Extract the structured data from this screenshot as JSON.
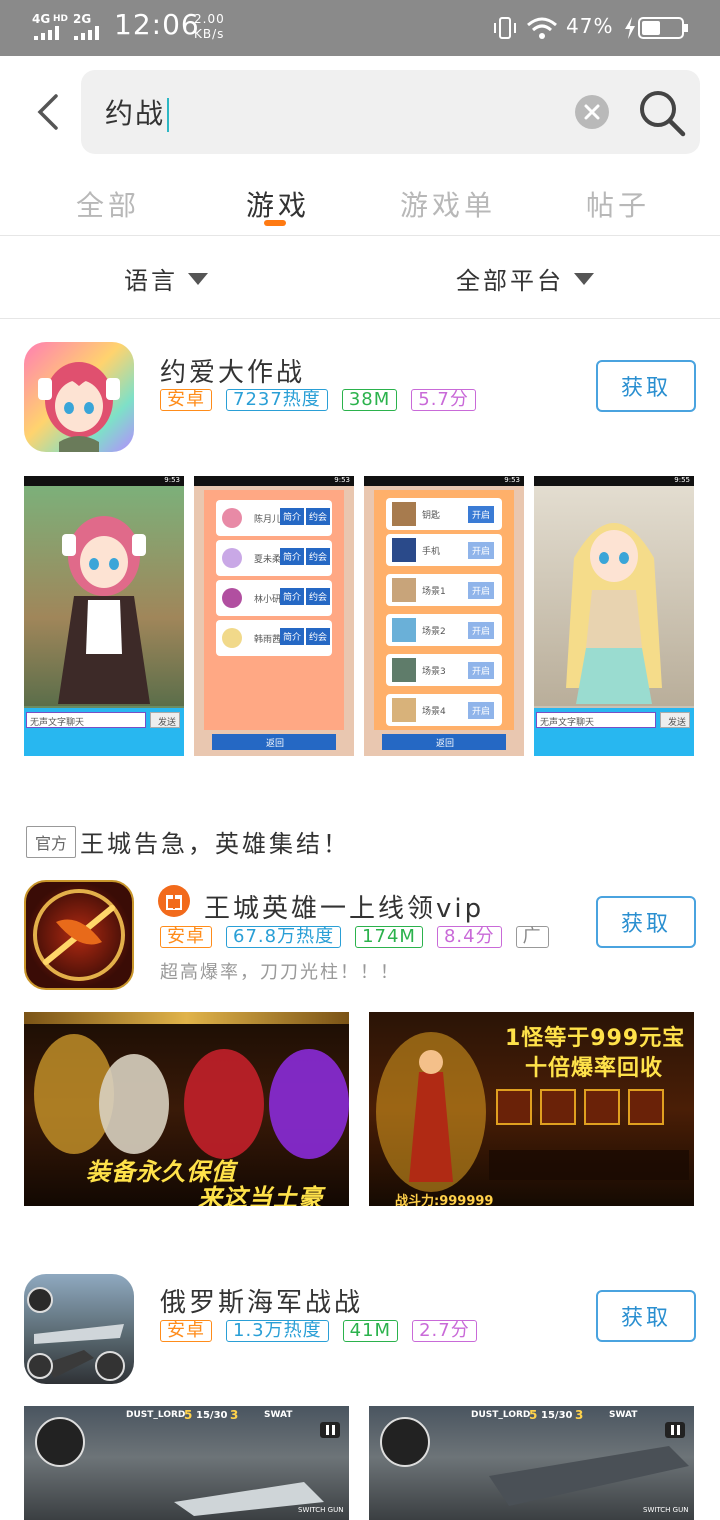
{
  "status_bar": {
    "network1": "4G",
    "network1_sup": "HD",
    "network2": "2G",
    "time": "12:06",
    "speed_value": "2.00",
    "speed_unit": "KB/s",
    "battery_percent": "47%"
  },
  "search": {
    "query": "约战"
  },
  "tabs": [
    {
      "label": "全部",
      "active": false
    },
    {
      "label": "游戏",
      "active": true
    },
    {
      "label": "游戏单",
      "active": false
    },
    {
      "label": "帖子",
      "active": false
    }
  ],
  "filters": {
    "language": "语言",
    "platform": "全部平台"
  },
  "apps": [
    {
      "title": "约爱大作战",
      "tags": [
        "安卓",
        "7237热度",
        "38M",
        "5.7分"
      ],
      "button": "获取"
    },
    {
      "title": "王城英雄一上线领vip",
      "tags": [
        "安卓",
        "67.8万热度",
        "174M",
        "8.4分",
        "广"
      ],
      "description": "超高爆率，刀刀光柱！！！",
      "button": "获取"
    },
    {
      "title": "俄罗斯海军战战",
      "tags": [
        "安卓",
        "1.3万热度",
        "41M",
        "2.7分"
      ],
      "button": "获取"
    }
  ],
  "official_section": {
    "badge": "官方",
    "title": "王城告急，英雄集结！"
  },
  "screens": {
    "phone_time_1": "9:53",
    "phone_time_2": "9:53",
    "phone_time_3": "9:53",
    "phone_time_4": "9:55",
    "chat_placeholder": "无声文字聊天",
    "send": "发送",
    "back": "返回",
    "list1": [
      {
        "name": "陈月儿",
        "b1": "简介",
        "b2": "约会"
      },
      {
        "name": "夏未柔",
        "b1": "简介",
        "b2": "约会"
      },
      {
        "name": "林小研",
        "b1": "简介",
        "b2": "约会"
      },
      {
        "name": "韩雨茜",
        "b1": "简介",
        "b2": "约会"
      }
    ],
    "list2": [
      {
        "name": "钥匙",
        "b": "开启"
      },
      {
        "name": "手机",
        "b": "开启"
      },
      {
        "name": "场景1",
        "b": "开启"
      },
      {
        "name": "场景2",
        "b": "开启"
      },
      {
        "name": "场景3",
        "b": "开启"
      },
      {
        "name": "场景4",
        "b": "开启"
      }
    ],
    "promo1": "装备永久保值",
    "promo2": "来这当土豪",
    "promo3": "1怪等于999元宝",
    "promo4": "十倍爆率回收",
    "power": "战斗力:999999",
    "hud_left": "DUST_LORD",
    "hud_score_a": "5",
    "hud_score": "15/30",
    "hud_score_b": "3",
    "hud_right": "SWAT",
    "switch_gun": "SWITCH GUN"
  }
}
